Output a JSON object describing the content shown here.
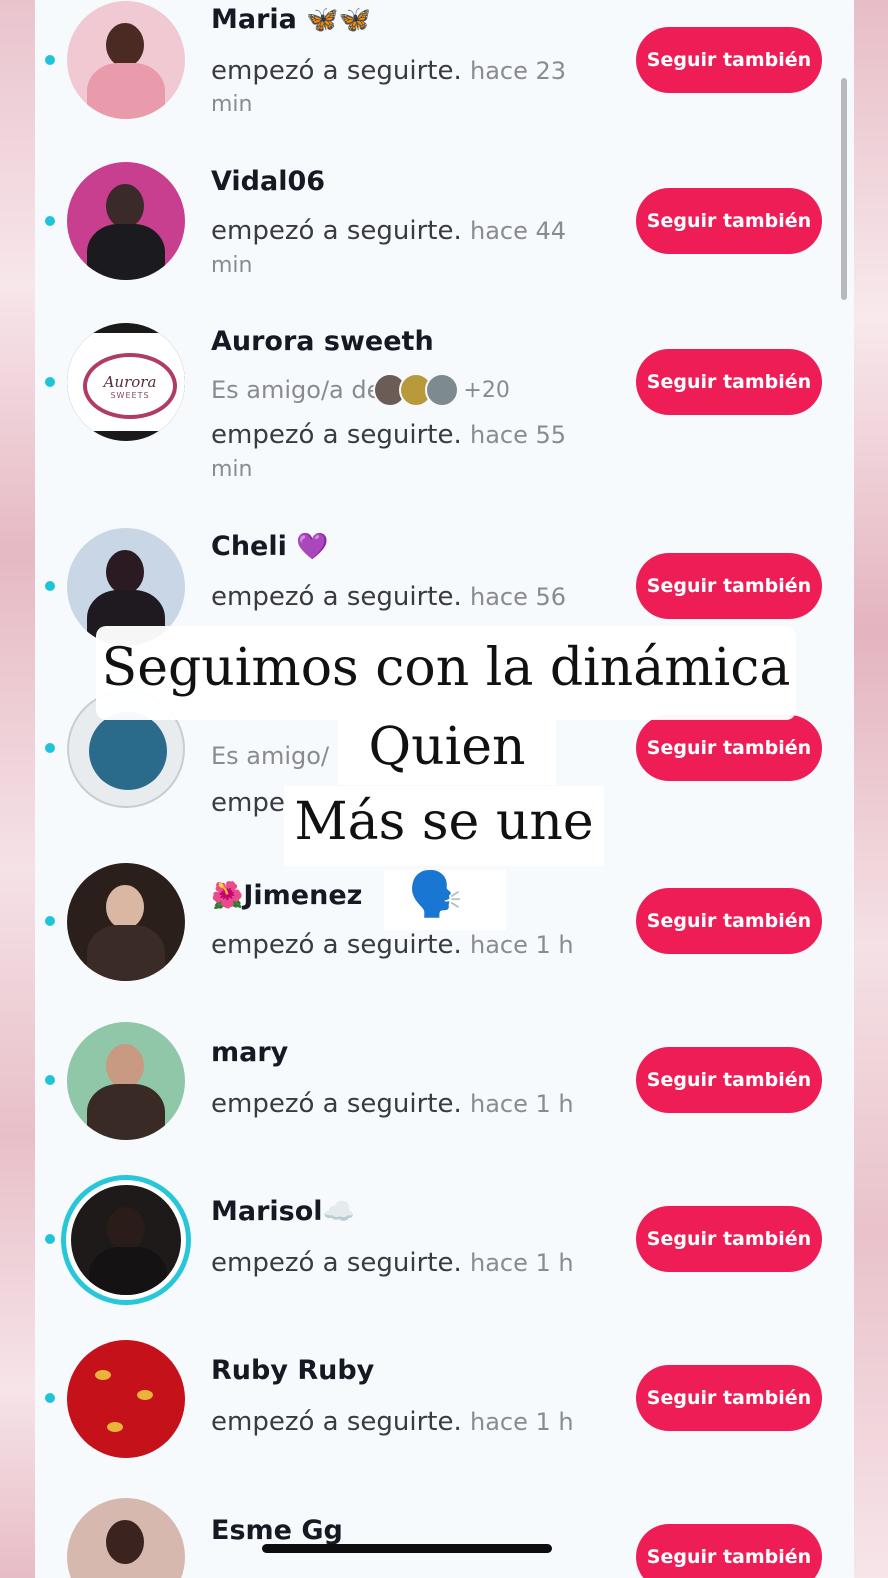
{
  "follow_label": "Seguir también",
  "rows": [
    {
      "name": "Maria",
      "name_emoji": "🦋🦋",
      "action": "empezó a seguirte.",
      "time_a": "hace 23",
      "time_b": "min"
    },
    {
      "name": "Vidal06",
      "name_emoji": "",
      "action": "empezó a seguirte.",
      "time_a": "hace 44",
      "time_b": "min"
    },
    {
      "name": "Aurora sweeth",
      "name_emoji": "",
      "friend_prefix": "Es amigo/a de",
      "friend_count": "+20",
      "action": "empezó a seguirte.",
      "time_a": "hace 55",
      "time_b": "min",
      "logo_text": "Aurora",
      "logo_sub": "SWEETS"
    },
    {
      "name": "Cheli",
      "name_emoji": "💜",
      "action": "empezó a seguirte.",
      "time_a": "hace 56"
    },
    {
      "friend_prefix": "Es amigo/",
      "action": "empe"
    },
    {
      "name": "Jimenez",
      "name_emoji_before": "🌺",
      "name_emoji": "🗣️",
      "action": "empezó a seguirte.",
      "time_a": "hace 1 h"
    },
    {
      "name": "mary",
      "name_emoji": "",
      "action": "empezó a seguirte.",
      "time_a": "hace 1 h"
    },
    {
      "name": "Marisol",
      "name_emoji": "☁️",
      "action": "empezó a seguirte.",
      "time_a": "hace 1 h"
    },
    {
      "name": "Ruby Ruby",
      "name_emoji": "",
      "action": "empezó a seguirte.",
      "time_a": "hace 1 h"
    },
    {
      "name": "Esme Gg",
      "name_emoji": ""
    }
  ],
  "overlay": {
    "line1": "Seguimos con la dinámica",
    "line2": "Quien",
    "line3": "Más se une"
  },
  "colors": {
    "follow_button": "#ee1d56",
    "unread_dot": "#20c4d8",
    "story_ring": "#27c7d9"
  }
}
